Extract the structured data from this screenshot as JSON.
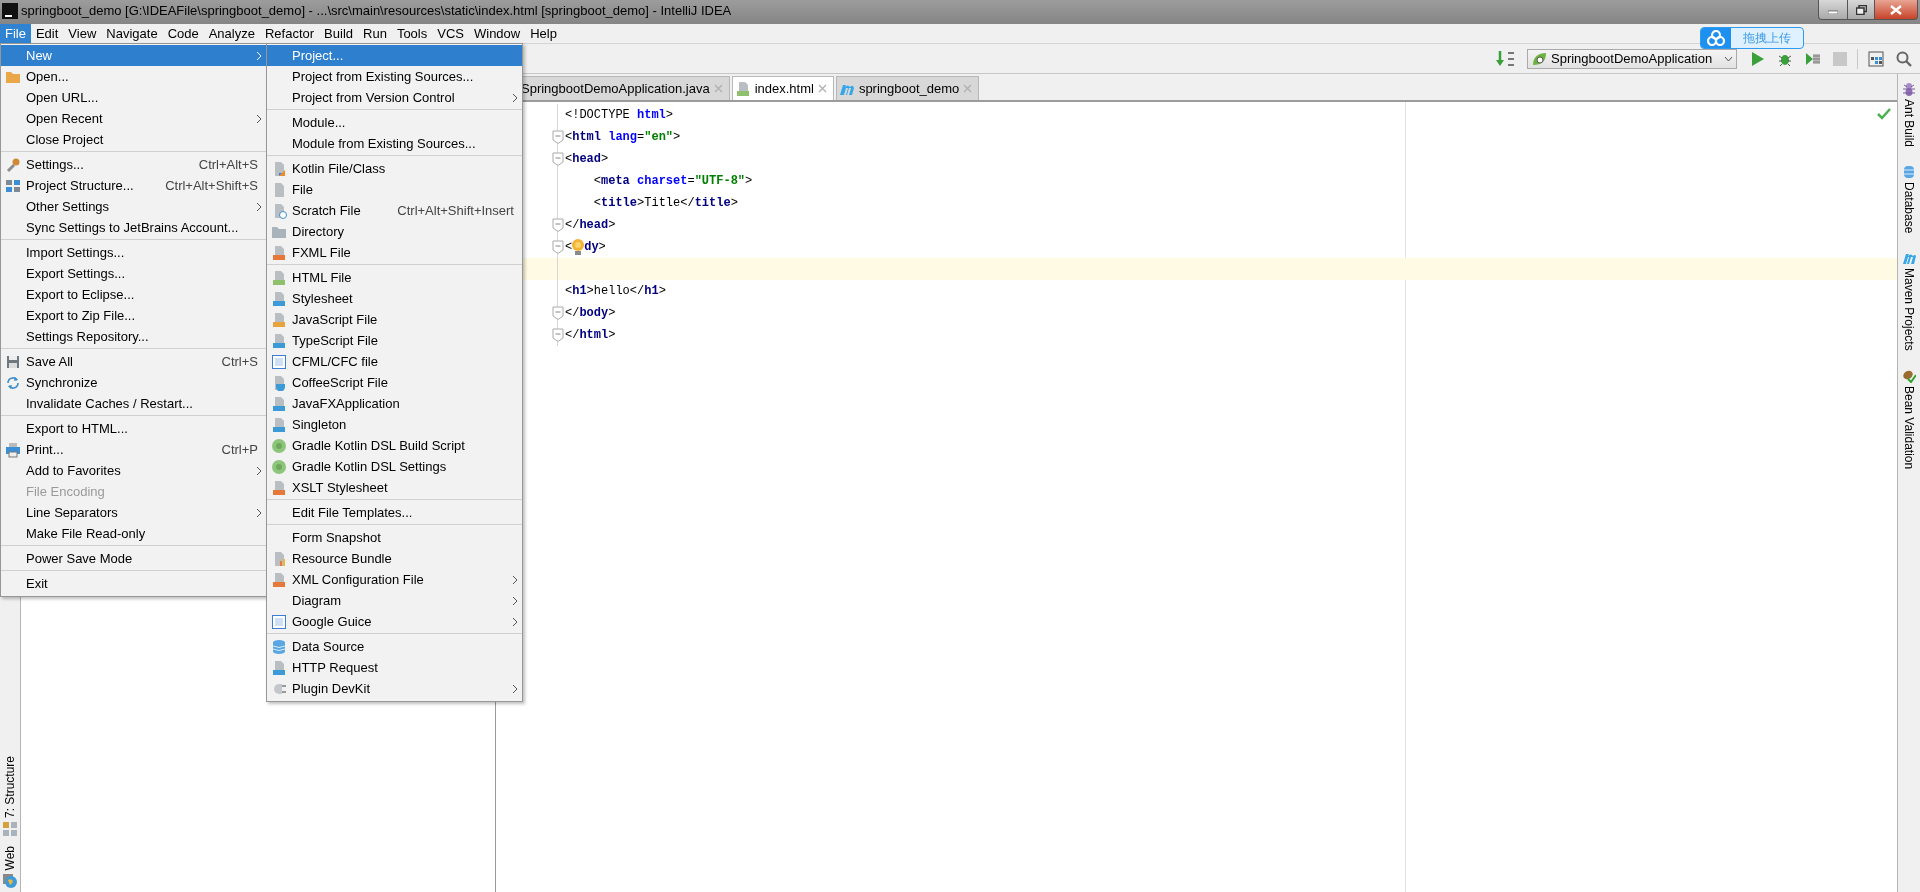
{
  "window": {
    "title": "springboot_demo [G:\\IDEAFile\\springboot_demo] - ...\\src\\main\\resources\\static\\index.html [springboot_demo] - IntelliJ IDEA"
  },
  "menu_bar": [
    {
      "label": "File",
      "selected": true
    },
    {
      "label": "Edit",
      "selected": false
    },
    {
      "label": "View",
      "selected": false
    },
    {
      "label": "Navigate",
      "selected": false
    },
    {
      "label": "Code",
      "selected": false
    },
    {
      "label": "Analyze",
      "selected": false
    },
    {
      "label": "Refactor",
      "selected": false
    },
    {
      "label": "Build",
      "selected": false
    },
    {
      "label": "Run",
      "selected": false
    },
    {
      "label": "Tools",
      "selected": false
    },
    {
      "label": "VCS",
      "selected": false
    },
    {
      "label": "Window",
      "selected": false
    },
    {
      "label": "Help",
      "selected": false
    }
  ],
  "toolbar": {
    "run_configuration": "SpringbootDemoApplication"
  },
  "upload_widget": {
    "label": "拖拽上传"
  },
  "file_menu": {
    "items": [
      {
        "kind": "item",
        "label": "New",
        "selected": true,
        "disabled": false,
        "has_submenu": true
      },
      {
        "kind": "item",
        "label": "Open...",
        "selected": false,
        "disabled": false,
        "has_submenu": false
      },
      {
        "kind": "item",
        "label": "Open URL...",
        "selected": false,
        "disabled": false,
        "has_submenu": false
      },
      {
        "kind": "item",
        "label": "Open Recent",
        "selected": false,
        "disabled": false,
        "has_submenu": true
      },
      {
        "kind": "item",
        "label": "Close Project",
        "selected": false,
        "disabled": false,
        "has_submenu": false
      },
      {
        "kind": "separator"
      },
      {
        "kind": "item",
        "label": "Settings...",
        "shortcut": "Ctrl+Alt+S",
        "selected": false,
        "disabled": false,
        "has_submenu": false
      },
      {
        "kind": "item",
        "label": "Project Structure...",
        "shortcut": "Ctrl+Alt+Shift+S",
        "selected": false,
        "disabled": false,
        "has_submenu": false
      },
      {
        "kind": "item",
        "label": "Other Settings",
        "selected": false,
        "disabled": false,
        "has_submenu": true
      },
      {
        "kind": "item",
        "label": "Sync Settings to JetBrains Account...",
        "selected": false,
        "disabled": false,
        "has_submenu": false
      },
      {
        "kind": "separator"
      },
      {
        "kind": "item",
        "label": "Import Settings...",
        "selected": false,
        "disabled": false,
        "has_submenu": false
      },
      {
        "kind": "item",
        "label": "Export Settings...",
        "selected": false,
        "disabled": false,
        "has_submenu": false
      },
      {
        "kind": "item",
        "label": "Export to Eclipse...",
        "selected": false,
        "disabled": false,
        "has_submenu": false
      },
      {
        "kind": "item",
        "label": "Export to Zip File...",
        "selected": false,
        "disabled": false,
        "has_submenu": false
      },
      {
        "kind": "item",
        "label": "Settings Repository...",
        "selected": false,
        "disabled": false,
        "has_submenu": false
      },
      {
        "kind": "separator"
      },
      {
        "kind": "item",
        "label": "Save All",
        "shortcut": "Ctrl+S",
        "selected": false,
        "disabled": false,
        "has_submenu": false
      },
      {
        "kind": "item",
        "label": "Synchronize",
        "selected": false,
        "disabled": false,
        "has_submenu": false
      },
      {
        "kind": "item",
        "label": "Invalidate Caches / Restart...",
        "selected": false,
        "disabled": false,
        "has_submenu": false
      },
      {
        "kind": "separator"
      },
      {
        "kind": "item",
        "label": "Export to HTML...",
        "selected": false,
        "disabled": false,
        "has_submenu": false
      },
      {
        "kind": "item",
        "label": "Print...",
        "shortcut": "Ctrl+P",
        "selected": false,
        "disabled": false,
        "has_submenu": false
      },
      {
        "kind": "item",
        "label": "Add to Favorites",
        "selected": false,
        "disabled": false,
        "has_submenu": true
      },
      {
        "kind": "item",
        "label": "File Encoding",
        "selected": false,
        "disabled": true,
        "has_submenu": false
      },
      {
        "kind": "item",
        "label": "Line Separators",
        "selected": false,
        "disabled": false,
        "has_submenu": true
      },
      {
        "kind": "item",
        "label": "Make File Read-only",
        "selected": false,
        "disabled": false,
        "has_submenu": false
      },
      {
        "kind": "separator"
      },
      {
        "kind": "item",
        "label": "Power Save Mode",
        "selected": false,
        "disabled": false,
        "has_submenu": false
      },
      {
        "kind": "separator"
      },
      {
        "kind": "item",
        "label": "Exit",
        "selected": false,
        "disabled": false,
        "has_submenu": false
      }
    ]
  },
  "new_submenu": {
    "items": [
      {
        "kind": "item",
        "label": "Project...",
        "selected": true,
        "disabled": false,
        "has_submenu": false
      },
      {
        "kind": "item",
        "label": "Project from Existing Sources...",
        "selected": false,
        "disabled": false,
        "has_submenu": false
      },
      {
        "kind": "item",
        "label": "Project from Version Control",
        "selected": false,
        "disabled": false,
        "has_submenu": true
      },
      {
        "kind": "separator"
      },
      {
        "kind": "item",
        "label": "Module...",
        "selected": false,
        "disabled": false,
        "has_submenu": false
      },
      {
        "kind": "item",
        "label": "Module from Existing Sources...",
        "selected": false,
        "disabled": false,
        "has_submenu": false
      },
      {
        "kind": "separator"
      },
      {
        "kind": "item",
        "label": "Kotlin File/Class",
        "selected": false,
        "disabled": false,
        "has_submenu": false
      },
      {
        "kind": "item",
        "label": "File",
        "selected": false,
        "disabled": false,
        "has_submenu": false
      },
      {
        "kind": "item",
        "label": "Scratch File",
        "shortcut": "Ctrl+Alt+Shift+Insert",
        "selected": false,
        "disabled": false,
        "has_submenu": false
      },
      {
        "kind": "item",
        "label": "Directory",
        "selected": false,
        "disabled": false,
        "has_submenu": false
      },
      {
        "kind": "item",
        "label": "FXML File",
        "selected": false,
        "disabled": false,
        "has_submenu": false
      },
      {
        "kind": "separator"
      },
      {
        "kind": "item",
        "label": "HTML File",
        "selected": false,
        "disabled": false,
        "has_submenu": false
      },
      {
        "kind": "item",
        "label": "Stylesheet",
        "selected": false,
        "disabled": false,
        "has_submenu": false
      },
      {
        "kind": "item",
        "label": "JavaScript File",
        "selected": false,
        "disabled": false,
        "has_submenu": false
      },
      {
        "kind": "item",
        "label": "TypeScript File",
        "selected": false,
        "disabled": false,
        "has_submenu": false
      },
      {
        "kind": "item",
        "label": "CFML/CFC file",
        "selected": false,
        "disabled": false,
        "has_submenu": false
      },
      {
        "kind": "item",
        "label": "CoffeeScript File",
        "selected": false,
        "disabled": false,
        "has_submenu": false
      },
      {
        "kind": "item",
        "label": "JavaFXApplication",
        "selected": false,
        "disabled": false,
        "has_submenu": false
      },
      {
        "kind": "item",
        "label": "Singleton",
        "selected": false,
        "disabled": false,
        "has_submenu": false
      },
      {
        "kind": "item",
        "label": "Gradle Kotlin DSL Build Script",
        "selected": false,
        "disabled": false,
        "has_submenu": false
      },
      {
        "kind": "item",
        "label": "Gradle Kotlin DSL Settings",
        "selected": false,
        "disabled": false,
        "has_submenu": false
      },
      {
        "kind": "item",
        "label": "XSLT Stylesheet",
        "selected": false,
        "disabled": false,
        "has_submenu": false
      },
      {
        "kind": "separator"
      },
      {
        "kind": "item",
        "label": "Edit File Templates...",
        "selected": false,
        "disabled": false,
        "has_submenu": false
      },
      {
        "kind": "separator"
      },
      {
        "kind": "item",
        "label": "Form Snapshot",
        "selected": false,
        "disabled": false,
        "has_submenu": false
      },
      {
        "kind": "item",
        "label": "Resource Bundle",
        "selected": false,
        "disabled": false,
        "has_submenu": false
      },
      {
        "kind": "item",
        "label": "XML Configuration File",
        "selected": false,
        "disabled": false,
        "has_submenu": true
      },
      {
        "kind": "item",
        "label": "Diagram",
        "selected": false,
        "disabled": false,
        "has_submenu": true
      },
      {
        "kind": "item",
        "label": "Google Guice",
        "selected": false,
        "disabled": false,
        "has_submenu": true
      },
      {
        "kind": "separator"
      },
      {
        "kind": "item",
        "label": "Data Source",
        "selected": false,
        "disabled": false,
        "has_submenu": false
      },
      {
        "kind": "item",
        "label": "HTTP Request",
        "selected": false,
        "disabled": false,
        "has_submenu": false
      },
      {
        "kind": "item",
        "label": "Plugin DevKit",
        "selected": false,
        "disabled": false,
        "has_submenu": true
      }
    ]
  },
  "editor_tabs": [
    {
      "label": "SpringbootDemoApplication.java",
      "selected": false
    },
    {
      "label": "index.html",
      "selected": true
    },
    {
      "label": "springboot_demo",
      "selected": false
    }
  ],
  "editor": {
    "lines": [
      {
        "fold": false,
        "current": false,
        "tokens": [
          {
            "kind": "punct",
            "text": "<!DOCTYPE "
          },
          {
            "kind": "attr",
            "text": "html"
          },
          {
            "kind": "punct",
            "text": ">"
          }
        ]
      },
      {
        "fold": true,
        "current": false,
        "tokens": [
          {
            "kind": "punct",
            "text": "<"
          },
          {
            "kind": "tag",
            "text": "html"
          },
          {
            "kind": "attr",
            "text": " lang"
          },
          {
            "kind": "punct",
            "text": "="
          },
          {
            "kind": "string",
            "text": "\"en\""
          },
          {
            "kind": "punct",
            "text": ">"
          }
        ]
      },
      {
        "fold": true,
        "current": false,
        "tokens": [
          {
            "kind": "punct",
            "text": "<"
          },
          {
            "kind": "tag",
            "text": "head"
          },
          {
            "kind": "punct",
            "text": ">"
          }
        ]
      },
      {
        "fold": false,
        "current": false,
        "tokens": [
          {
            "kind": "punct",
            "text": "    <"
          },
          {
            "kind": "tag",
            "text": "meta"
          },
          {
            "kind": "attr",
            "text": " charset"
          },
          {
            "kind": "punct",
            "text": "="
          },
          {
            "kind": "string",
            "text": "\"UTF-8\""
          },
          {
            "kind": "punct",
            "text": ">"
          }
        ]
      },
      {
        "fold": false,
        "current": false,
        "tokens": [
          {
            "kind": "punct",
            "text": "    <"
          },
          {
            "kind": "tag",
            "text": "title"
          },
          {
            "kind": "punct",
            "text": ">"
          },
          {
            "kind": "text",
            "text": "Title"
          },
          {
            "kind": "punct",
            "text": "</"
          },
          {
            "kind": "tag",
            "text": "title"
          },
          {
            "kind": "punct",
            "text": ">"
          }
        ]
      },
      {
        "fold": true,
        "current": false,
        "tokens": [
          {
            "kind": "punct",
            "text": "</"
          },
          {
            "kind": "tag",
            "text": "head"
          },
          {
            "kind": "punct",
            "text": ">"
          }
        ]
      },
      {
        "fold": true,
        "current": false,
        "tokens": [
          {
            "kind": "punct",
            "text": "<"
          },
          {
            "kind": "bulb"
          },
          {
            "kind": "tag",
            "text": "dy"
          },
          {
            "kind": "punct",
            "text": ">"
          }
        ]
      },
      {
        "fold": false,
        "current": true
      },
      {
        "fold": false,
        "current": false,
        "tokens": [
          {
            "kind": "punct",
            "text": "<"
          },
          {
            "kind": "tag",
            "text": "h1"
          },
          {
            "kind": "punct",
            "text": ">"
          },
          {
            "kind": "text",
            "text": "hello"
          },
          {
            "kind": "punct",
            "text": "</"
          },
          {
            "kind": "tag",
            "text": "h1"
          },
          {
            "kind": "punct",
            "text": ">"
          }
        ]
      },
      {
        "fold": true,
        "current": false,
        "tokens": [
          {
            "kind": "punct",
            "text": "</"
          },
          {
            "kind": "tag",
            "text": "body"
          },
          {
            "kind": "punct",
            "text": ">"
          }
        ]
      },
      {
        "fold": true,
        "current": false,
        "tokens": [
          {
            "kind": "punct",
            "text": "</"
          },
          {
            "kind": "tag",
            "text": "html"
          },
          {
            "kind": "punct",
            "text": ">"
          }
        ]
      }
    ]
  },
  "right_tool_windows": [
    {
      "label": "Ant Build"
    },
    {
      "label": "Database"
    },
    {
      "label": "Maven Projects"
    },
    {
      "label": "Bean Validation"
    }
  ],
  "left_tool_windows": [
    {
      "label": "7: Structure"
    },
    {
      "label": "Web"
    }
  ]
}
